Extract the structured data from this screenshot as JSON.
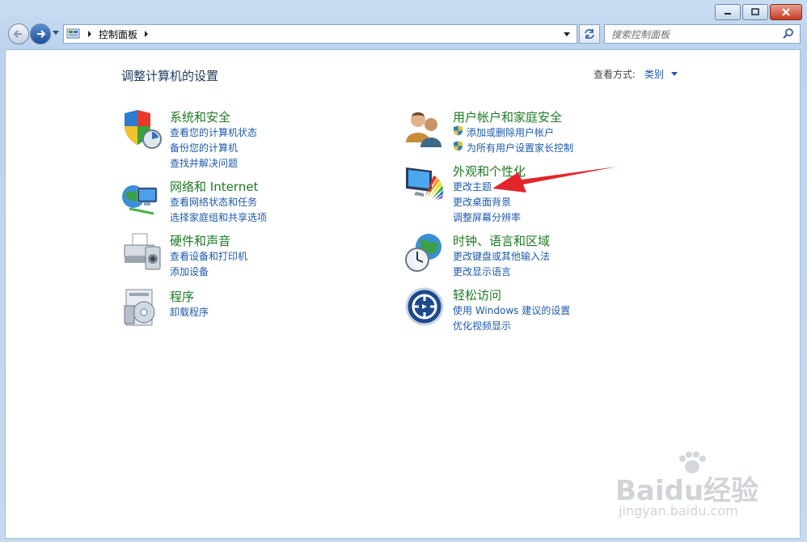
{
  "window": {
    "minimize_icon": "minimize-icon",
    "maximize_icon": "maximize-icon",
    "close_icon": "close-icon"
  },
  "address_bar": {
    "breadcrumb": "控制面板",
    "search_placeholder": "搜索控制面板"
  },
  "page": {
    "heading": "调整计算机的设置",
    "view_by_label": "查看方式:",
    "view_by_value": "类别"
  },
  "categories": [
    {
      "title": "系统和安全",
      "icon": "security-shield-icon",
      "links": [
        "查看您的计算机状态",
        "备份您的计算机",
        "查找并解决问题"
      ]
    },
    {
      "title": "网络和 Internet",
      "icon": "network-globe-icon",
      "links": [
        "查看网络状态和任务",
        "选择家庭组和共享选项"
      ]
    },
    {
      "title": "硬件和声音",
      "icon": "printer-icon",
      "links": [
        "查看设备和打印机",
        "添加设备"
      ]
    },
    {
      "title": "程序",
      "icon": "programs-disc-icon",
      "links": [
        "卸载程序"
      ]
    },
    {
      "title": "用户帐户和家庭安全",
      "icon": "users-icon",
      "links": [
        "添加或删除用户帐户",
        "为所有用户设置家长控制"
      ]
    },
    {
      "title": "外观和个性化",
      "icon": "monitor-colors-icon",
      "links": [
        "更改主题",
        "更改桌面背景",
        "调整屏幕分辨率"
      ]
    },
    {
      "title": "时钟、语言和区域",
      "icon": "clock-globe-icon",
      "links": [
        "更改键盘或其他输入法",
        "更改显示语言"
      ]
    },
    {
      "title": "轻松访问",
      "icon": "ease-of-access-icon",
      "links": [
        "使用 Windows 建议的设置",
        "优化视频显示"
      ]
    }
  ],
  "watermark": {
    "logo": "Baidu经验",
    "url": "jingyan.baidu.com"
  }
}
